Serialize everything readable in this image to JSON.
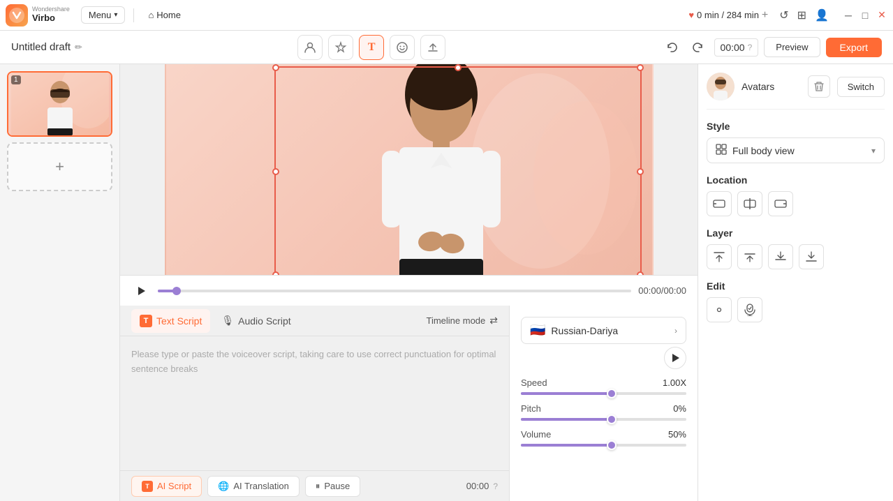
{
  "app": {
    "logo_text": "Virbo",
    "logo_abbr": "W",
    "menu_label": "Menu",
    "home_label": "Home",
    "time_info": "0 min / 284 min"
  },
  "header": {
    "draft_title": "Untitled draft",
    "preview_label": "Preview",
    "export_label": "Export",
    "time_display": "00:00",
    "help_icon": "?"
  },
  "toolbar": {
    "tools": [
      {
        "name": "avatar-tool",
        "icon": "👤",
        "label": "Avatar"
      },
      {
        "name": "effects-tool",
        "icon": "✦",
        "label": "Effects"
      },
      {
        "name": "text-tool",
        "icon": "T",
        "label": "Text"
      },
      {
        "name": "sticker-tool",
        "icon": "😊",
        "label": "Sticker"
      },
      {
        "name": "upload-tool",
        "icon": "↑",
        "label": "Upload"
      }
    ]
  },
  "playback": {
    "time_current": "00:00",
    "time_total": "00:00",
    "progress_pct": 4
  },
  "script": {
    "text_tab_label": "Text Script",
    "audio_tab_label": "Audio Script",
    "timeline_mode_label": "Timeline mode",
    "placeholder_text": "Please type or paste the voiceover script, taking care to use correct punctuation for optimal sentence breaks",
    "ai_script_label": "AI Script",
    "ai_translation_label": "AI Translation",
    "pause_label": "Pause",
    "timer_label": "00:00",
    "active_tab": "text"
  },
  "voice": {
    "language": "Russian-Dariya",
    "flag": "🇷🇺",
    "speed_label": "Speed",
    "speed_value": "1.00X",
    "speed_pct": 55,
    "pitch_label": "Pitch",
    "pitch_value": "0%",
    "pitch_pct": 55,
    "volume_label": "Volume",
    "volume_value": "50%",
    "volume_pct": 55
  },
  "right_panel": {
    "avatars_label": "Avatars",
    "switch_label": "Switch",
    "delete_icon": "🗑",
    "style_section": {
      "title": "Style",
      "dropdown_icon": "⊞",
      "selected": "Full body view"
    },
    "location_section": {
      "title": "Location",
      "buttons": [
        "align-left",
        "align-center",
        "align-right"
      ]
    },
    "layer_section": {
      "title": "Layer",
      "buttons": [
        "layer-top",
        "layer-up",
        "layer-down",
        "layer-bottom"
      ]
    },
    "edit_section": {
      "title": "Edit",
      "buttons": [
        "edit-appearance",
        "edit-voice"
      ]
    }
  },
  "slides": [
    {
      "number": 1,
      "active": true
    }
  ],
  "add_slide_label": "+"
}
